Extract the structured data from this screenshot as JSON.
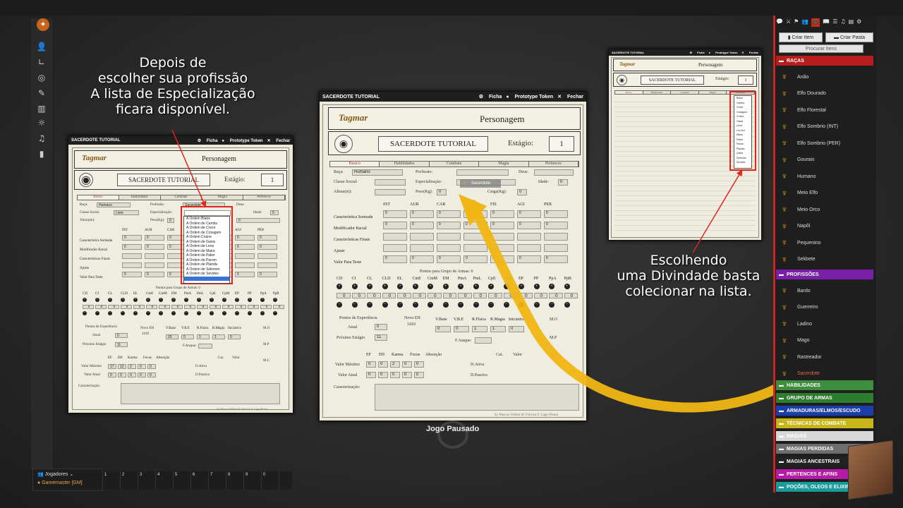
{
  "annotations": {
    "left": [
      "Depois de",
      "escolher sua profissão",
      "A lista de Especialização",
      "ficara disponível."
    ],
    "right": [
      "Escolhendo",
      "uma Divindade basta",
      "colecionar na lista."
    ]
  },
  "window": {
    "title": "SACERDOTE TUTORIAL",
    "ficha": "Ficha",
    "prototype": "Prototype Token",
    "fechar": "Fechar"
  },
  "sheet": {
    "logo": "Tagmar",
    "personagem": "Personagem",
    "char_name": "SACERDOTE TUTORIAL",
    "stage_label": "Estágio:",
    "stage_value": "1",
    "tabs": [
      "Básico",
      "Habilidades",
      "Combate",
      "Magia",
      "Pertences"
    ],
    "labels": {
      "raca": "Raça:",
      "profissao": "Profissão:",
      "deus": "Deus:",
      "classe_social": "Classe Social:",
      "especializacao": "Especialização:",
      "idade": "Idade:",
      "altura": "Altura(m):",
      "peso": "Peso(Kg):",
      "carga": "Carga(Kg):"
    },
    "values": {
      "raca": "Humano",
      "profissao": "Sacerdote",
      "classe_social": "Livre",
      "idade": "0",
      "peso": "0",
      "carga": "0"
    },
    "attr_headers": [
      "INT",
      "AUR",
      "CAR",
      "FOR",
      "FIS",
      "AGI",
      "PER"
    ],
    "attr_rows": [
      "Característica Sorteada",
      "Modificador Racial",
      "Características Finais",
      "Ajuste",
      "Valor Para Teste"
    ],
    "weapon_group_title": "Pontos para Grupo de Armas: 0",
    "weapon_headers": [
      "CD",
      "CI",
      "CL",
      "CLD",
      "EL",
      "CmE",
      "CmM",
      "EM",
      "PmA",
      "PmL",
      "CpE",
      "CpM",
      "EP",
      "PP",
      "PpA",
      "PpB"
    ],
    "xp": {
      "title": "Pontos de Experiência",
      "atual": "Atual",
      "atual_val": "0",
      "prox": "Próximo Estágio",
      "prox_val": "11",
      "novo_eh": "Novo EH",
      "dice": "1d10"
    },
    "defense_headers": [
      "V.Base",
      "V.B.E",
      "R.Física",
      "R.Magia",
      "Iniciativa"
    ],
    "defense_values": [
      "0",
      "0",
      "1",
      "1",
      "0"
    ],
    "mo": "M.O",
    "mp": "M.P",
    "mc": "M.C",
    "fataque": "F.Ataque:",
    "ef_headers": [
      "EF",
      "EH",
      "Karma",
      "Focus",
      "Absorção"
    ],
    "valor_maximo": "Valor Máximo",
    "valor_atual": "Valor Atual",
    "vm_values": [
      "0",
      "0",
      "2",
      "0",
      "0"
    ],
    "va_values": [
      "0",
      "0",
      "0",
      "0",
      "0"
    ],
    "cat": "Cat.",
    "valor": "Valor",
    "dativa": "D.Ativa",
    "dpassiva": "D.Passiva",
    "caracterizacao": "Caracterização:",
    "credits": "by Marcus Walker & Vinicius F. Lage (Pena)",
    "drag_token": "Sacerdote"
  },
  "left_sheet_values": {
    "vm_values": [
      "17",
      "12",
      "2",
      "0",
      "0"
    ],
    "defense_values": [
      "20",
      "0",
      "1",
      "1",
      "0"
    ]
  },
  "dropdown_specializations": [
    "A Ordem Blator",
    "A Ordem de Cambu",
    "A Ordem de Crezir",
    "A Ordem de Crizagom",
    "A Ordem Cruine",
    "A Ordem de Ganis",
    "A Ordem de Lena",
    "A Ordem de Maira",
    "A Ordem de Palier",
    "A Ordem de Parom",
    "A Ordem de Plandis",
    "A Ordem de Selimom",
    "A Ordem de Sevides",
    ""
  ],
  "dropdown_gods": [
    "Blator",
    "Cambu",
    "Crezir",
    "Crizagom",
    "Cruine",
    "Ganis",
    "Lena",
    "Lin-Ora",
    "Maira",
    "Palier",
    "Parom",
    "Plandis",
    "Quiris",
    "Selimom",
    "Sevides"
  ],
  "paused": "Jogo Pausado",
  "sidebar": {
    "create_item": "Criar Item",
    "create_folder": "Criar Pasta",
    "search": "Procurar Itens",
    "folders": [
      {
        "name": "RAÇAS",
        "color": "#b81d1d",
        "items": [
          "Anão",
          "Elfo Dourado",
          "Elfo Florestal",
          "Elfo Sombrio (INT)",
          "Elfo Sombrio (PER)",
          "Gourais",
          "Humano",
          "Meio Elfo",
          "Meio Orco",
          "Napôl",
          "Pequenino",
          "Sekbete"
        ]
      },
      {
        "name": "PROFISSÕES",
        "color": "#7a1fa8",
        "items": [
          "Bardo",
          "Guerreiro",
          "Ladino",
          "Mago",
          "Rastreador",
          "Sacerdote"
        ]
      }
    ],
    "other_folders": [
      {
        "name": "HABILIDADES",
        "color": "#3e8e3e"
      },
      {
        "name": "GRUPO DE ARMAS",
        "color": "#2e7d2e"
      },
      {
        "name": "ARMADURAS/ELMOS/ESCUDO",
        "color": "#1a3fa8"
      },
      {
        "name": "TÉCNICAS DE COMBATE",
        "color": "#c8b51a"
      },
      {
        "name": "MAGIAS",
        "color": "#d8d8d8"
      },
      {
        "name": "MAGIAS PERDIDAS",
        "color": "#6e6e6e"
      },
      {
        "name": "MAGIAS ANCESTRAIS",
        "color": "#222222"
      },
      {
        "name": "PERTENCES E AFINS",
        "color": "#b71aa8"
      },
      {
        "name": "POÇÕES, OLEOS E ELIXIRES",
        "color": "#1a9b9b"
      }
    ]
  },
  "players": {
    "title": "Jogadores",
    "gm": "Gamemaster [GM]"
  },
  "macro_slots": [
    "1",
    "2",
    "3",
    "4",
    "5",
    "6",
    "7",
    "8",
    "9",
    "0"
  ]
}
